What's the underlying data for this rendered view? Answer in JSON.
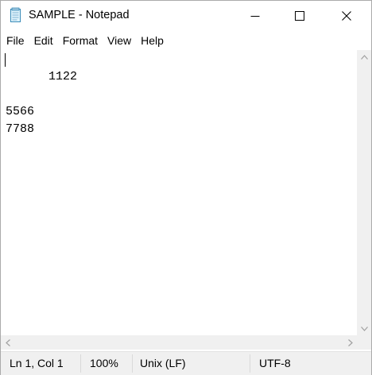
{
  "window": {
    "title": "SAMPLE - Notepad",
    "app_icon": "notepad-icon",
    "controls": [
      "minimize-icon",
      "maximize-icon",
      "close-icon"
    ]
  },
  "menu": {
    "items": [
      "File",
      "Edit",
      "Format",
      "View",
      "Help"
    ]
  },
  "editor": {
    "lines": [
      "1122",
      "5566",
      "7788"
    ]
  },
  "statusbar": {
    "position": "Ln 1, Col 1",
    "zoom": "100%",
    "line_ending": "Unix (LF)",
    "encoding": "UTF-8"
  },
  "colors": {
    "chrome_bg": "#f0f0f0",
    "editor_bg": "#ffffff",
    "text": "#000000"
  }
}
